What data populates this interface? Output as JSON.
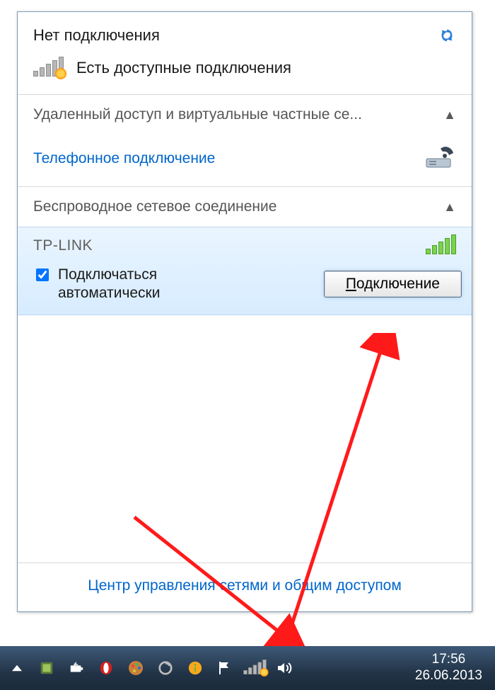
{
  "flyout": {
    "title": "Нет подключения",
    "available_label": "Есть доступные подключения",
    "sections": {
      "vpn_header": "Удаленный доступ и виртуальные частные се...",
      "dialup_label": "Телефонное подключение",
      "wlan_header": "Беспроводное сетевое соединение"
    },
    "network": {
      "ssid": "TP-LINK",
      "auto_connect_label": "Подключаться автоматически",
      "auto_connect_checked": true,
      "connect_button_prefix": "П",
      "connect_button_rest": "одключение"
    },
    "footer_link": "Центр управления сетями и общим доступом"
  },
  "taskbar": {
    "time": "17:56",
    "date": "26.06.2013"
  }
}
